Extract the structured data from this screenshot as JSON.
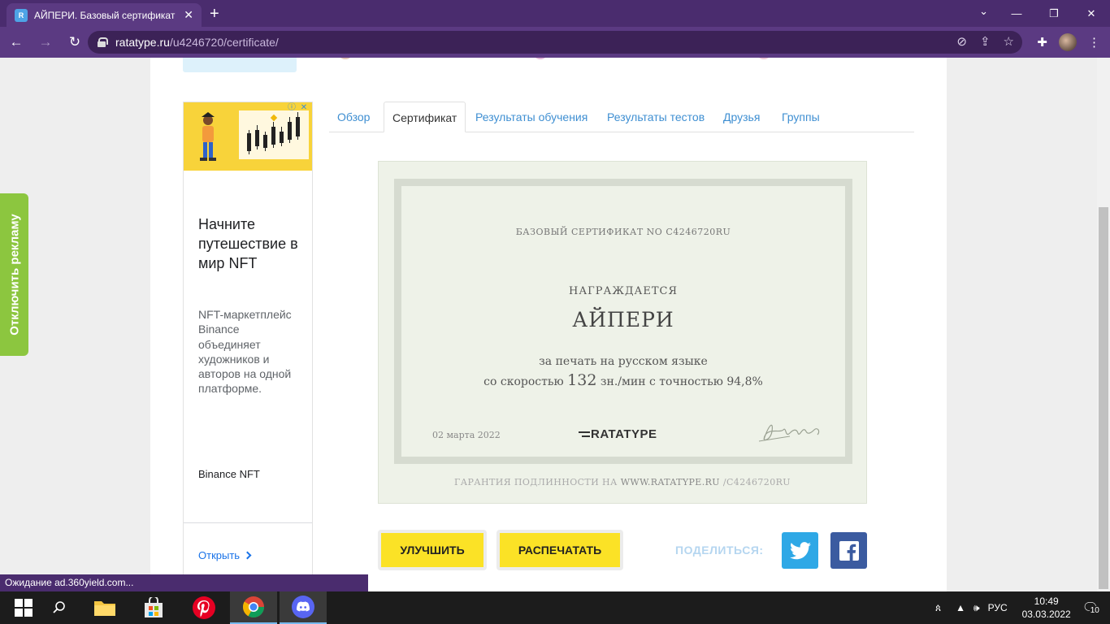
{
  "browser": {
    "tab_title": "АЙПЕРИ. Базовый сертификат п",
    "tab_favicon": "R",
    "url_host": "ratatype.ru",
    "url_path": "/u4246720/certificate/"
  },
  "adblock": {
    "label": "Отключить рекламу"
  },
  "ad": {
    "headline": "Начните путешествие в мир NFT",
    "body": "NFT-маркетплейс Binance объединяет художников и авторов на одной платформе.",
    "brand": "Binance NFT",
    "cta": "Открыть"
  },
  "tabs": [
    {
      "label": "Обзор",
      "active": false
    },
    {
      "label": "Сертификат",
      "active": true
    },
    {
      "label": "Результаты обучения",
      "active": false
    },
    {
      "label": "Результаты тестов",
      "active": false
    },
    {
      "label": "Друзья",
      "active": false
    },
    {
      "label": "Группы",
      "active": false
    }
  ],
  "certificate": {
    "number_line": "БАЗОВЫЙ СЕРТИФИКАТ NO C4246720RU",
    "awarded": "НАГРАЖДАЕТСЯ",
    "name": "АЙПЕРИ",
    "line1": "за печать на русском языке",
    "speed_prefix": "со скоростью",
    "speed": "132",
    "speed_suffix": "зн./мин с точностью 94,8%",
    "date": "02 марта 2022",
    "logo": "RATATYPE",
    "guarantee_prefix": "ГАРАНТИЯ ПОДЛИННОСТИ НА",
    "guarantee_site": "WWW.RATATYPE.RU",
    "guarantee_suffix": "/C4246720RU"
  },
  "actions": {
    "improve": "УЛУЧШИТЬ",
    "print": "РАСПЕЧАТАТЬ",
    "share": "ПОДЕЛИТЬСЯ:"
  },
  "status_bar": "Ожидание ad.360yield.com...",
  "taskbar": {
    "language": "РУС",
    "time": "10:49",
    "date": "03.03.2022",
    "notifications": "10"
  },
  "colors": {
    "browser_frame": "#4a2c6e",
    "accent_yellow": "#fbe226",
    "link_blue": "#3f8fd2",
    "adblock_green": "#8cc63f",
    "twitter": "#2ea8e6",
    "facebook": "#3b5ba0"
  }
}
